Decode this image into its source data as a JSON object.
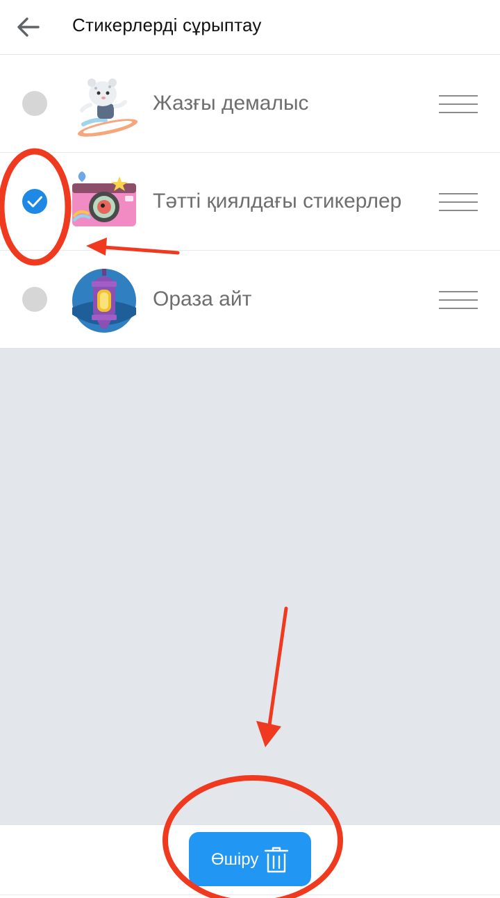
{
  "header": {
    "title": "Стикерлерді сұрыптау",
    "back_icon": "arrow-left-icon"
  },
  "sticker_packs": [
    {
      "label": "Жазғы демалыс",
      "selected": false,
      "thumbnail": "snow-leopard-surfing-sticker"
    },
    {
      "label": "Тәтті қиялдағы стикерлер",
      "selected": true,
      "thumbnail": "pink-camera-sticker"
    },
    {
      "label": "Ораза айт",
      "selected": false,
      "thumbnail": "lantern-sticker"
    }
  ],
  "footer": {
    "delete_label": "Өшіру",
    "delete_icon": "trash-icon"
  },
  "colors": {
    "accent": "#2196f3",
    "checked": "#1e88e5",
    "unchecked": "#d6d6d6",
    "annotation": "#f03a1f",
    "background": "#e3e7ec"
  }
}
